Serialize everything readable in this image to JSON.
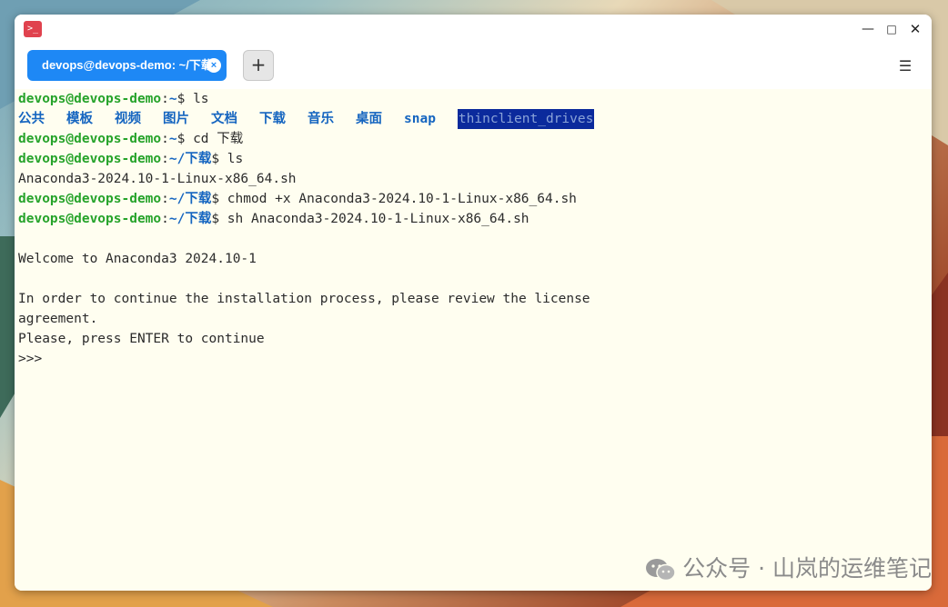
{
  "window": {
    "app_icon_glyph": ">_",
    "controls": {
      "minimize": "—",
      "maximize": "□",
      "close": "✕"
    }
  },
  "tabs": [
    {
      "label": "devops@devops-demo: ~/下载",
      "close": "×"
    }
  ],
  "new_tab_label": "+",
  "menu_label": "☰",
  "terminal": {
    "user": "devops@devops-demo",
    "lines": [
      {
        "type": "cmd",
        "path": "~",
        "cmd": " ls"
      },
      {
        "type": "dirs",
        "items": [
          "公共",
          "模板",
          "视频",
          "图片",
          "文档",
          "下载",
          "音乐",
          "桌面",
          "snap"
        ],
        "highlighted": "thinclient_drives"
      },
      {
        "type": "cmd",
        "path": "~",
        "cmd": " cd 下载"
      },
      {
        "type": "cmd",
        "path": "~/下载",
        "cmd": " ls"
      },
      {
        "type": "text",
        "text": "Anaconda3-2024.10-1-Linux-x86_64.sh"
      },
      {
        "type": "cmd",
        "path": "~/下载",
        "cmd": " chmod +x Anaconda3-2024.10-1-Linux-x86_64.sh"
      },
      {
        "type": "cmd",
        "path": "~/下载",
        "cmd": " sh Anaconda3-2024.10-1-Linux-x86_64.sh"
      },
      {
        "type": "text",
        "text": ""
      },
      {
        "type": "text",
        "text": "Welcome to Anaconda3 2024.10-1"
      },
      {
        "type": "text",
        "text": ""
      },
      {
        "type": "text",
        "text": "In order to continue the installation process, please review the license"
      },
      {
        "type": "text",
        "text": "agreement."
      },
      {
        "type": "text",
        "text": "Please, press ENTER to continue"
      },
      {
        "type": "text",
        "text": ">>>"
      }
    ]
  },
  "watermark": {
    "text": "公众号 · 山岚的运维笔记",
    "icon": "wechat-icon"
  },
  "colors": {
    "user": "#26a32a",
    "path": "#1565c0",
    "tab": "#1e88f5",
    "highlight_bg": "#0b2a9c"
  }
}
